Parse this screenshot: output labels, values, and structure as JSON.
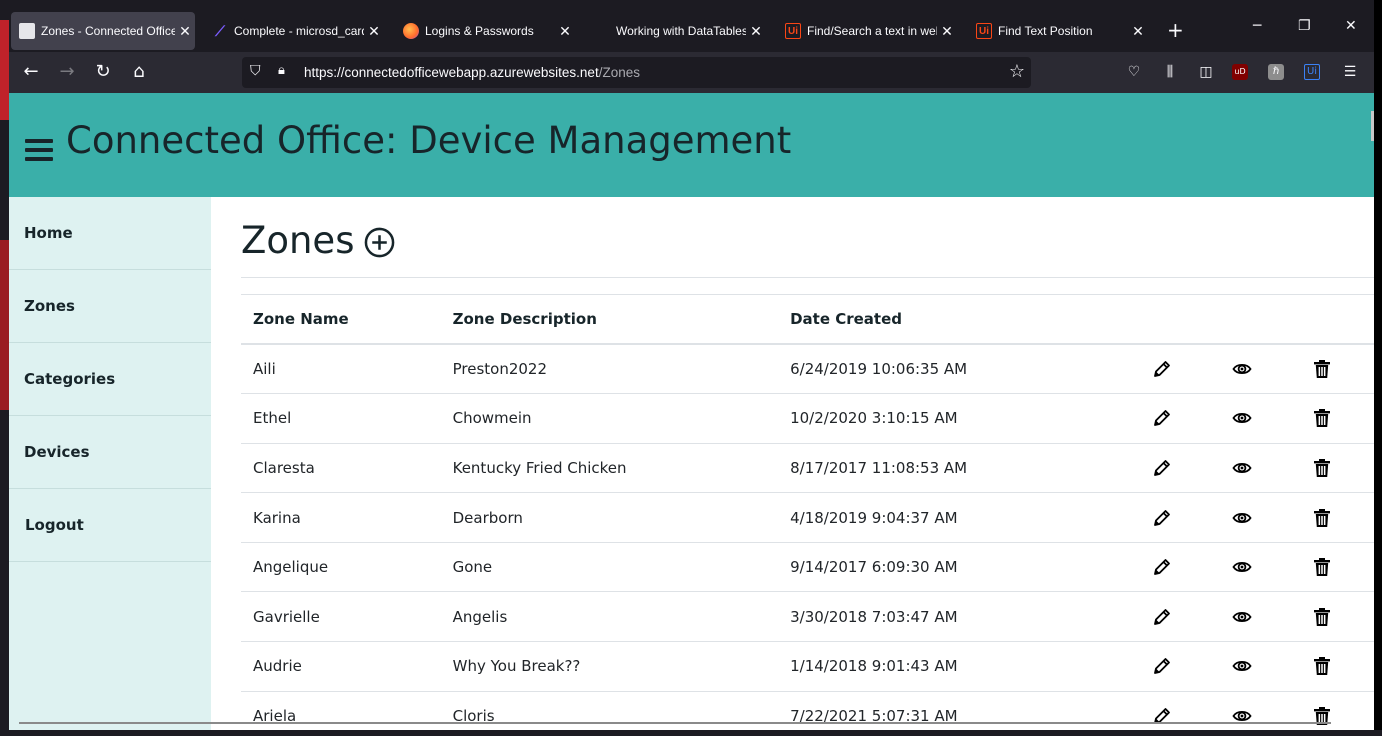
{
  "browser": {
    "tabs": [
      {
        "title": "Zones - Connected Office",
        "icon": "document-icon",
        "active": true
      },
      {
        "title": "Complete - microsd_card",
        "icon": "ms-logo-icon",
        "active": false
      },
      {
        "title": "Logins & Passwords",
        "icon": "firefox-icon",
        "active": false
      },
      {
        "title": "Working with DataTables",
        "icon": "blank-icon",
        "active": false
      },
      {
        "title": "Find/Search a text in web",
        "icon": "uipath-icon",
        "active": false
      },
      {
        "title": "Find Text Position",
        "icon": "uipath-icon",
        "active": false
      }
    ],
    "tab_close": "✕",
    "new_tab": "+",
    "window": {
      "minimize": "─",
      "restore": "❐",
      "close": "✕"
    },
    "url_host": "https://connectedofficewebapp.azurewebsites.net",
    "url_path": "/Zones",
    "badge_ui": "Ui",
    "badge_ublock": "uD"
  },
  "app": {
    "title": "Connected Office: Device Management",
    "accent": "#3aafa9",
    "sidebar_bg": "#def2f1",
    "text_color": "#17252a"
  },
  "sidebar": {
    "items": [
      {
        "label": "Home"
      },
      {
        "label": "Zones"
      },
      {
        "label": "Categories"
      },
      {
        "label": "Devices"
      },
      {
        "label": "Logout"
      }
    ]
  },
  "main": {
    "heading": "Zones",
    "columns": [
      "Zone Name",
      "Zone Description",
      "Date Created"
    ],
    "rows": [
      [
        "Aili",
        "Preston2022",
        "6/24/2019 10:06:35 AM"
      ],
      [
        "Ethel",
        "Chowmein",
        "10/2/2020 3:10:15 AM"
      ],
      [
        "Claresta",
        "Kentucky Fried Chicken",
        "8/17/2017 11:08:53 AM"
      ],
      [
        "Karina",
        "Dearborn",
        "4/18/2019 9:04:37 AM"
      ],
      [
        "Angelique",
        "Gone",
        "9/14/2017 6:09:30 AM"
      ],
      [
        "Gavrielle",
        "Angelis",
        "3/30/2018 7:03:47 AM"
      ],
      [
        "Audrie",
        "Why You Break??",
        "1/14/2018 9:01:43 AM"
      ],
      [
        "Ariela",
        "Cloris",
        "7/22/2021 5:07:31 AM"
      ]
    ],
    "row_actions": [
      "edit-icon",
      "view-icon",
      "delete-icon"
    ]
  }
}
